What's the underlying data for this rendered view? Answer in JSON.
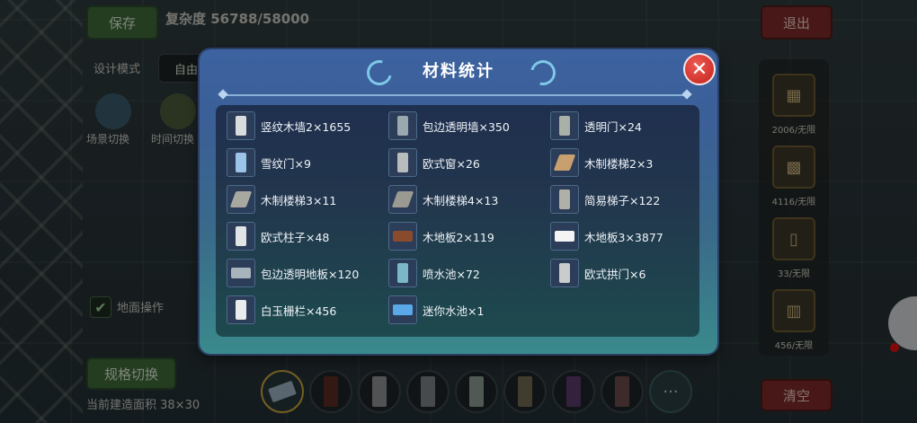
{
  "hud": {
    "save_label": "保存",
    "complexity_label": "复杂度 56788/58000",
    "exit_label": "退出",
    "design_mode_label": "设计模式",
    "free_label": "自由",
    "scene_switch_label": "场景切换",
    "time_switch_label": "时间切换",
    "ground_op_label": "地面操作",
    "spec_switch_label": "规格切换",
    "build_area_label": "当前建造面积 38×30",
    "clear_label": "清空"
  },
  "side_panel": {
    "items": [
      {
        "count": "2006/无限"
      },
      {
        "count": "4116/无限"
      },
      {
        "count": "33/无限"
      },
      {
        "count": "456/无限"
      }
    ]
  },
  "hotbar": {
    "slots": [
      {
        "color": "#9ab0c0",
        "selected": true
      },
      {
        "color": "#5a2a22"
      },
      {
        "color": "#8a8e90"
      },
      {
        "color": "#7a8084"
      },
      {
        "color": "#8a9a90"
      },
      {
        "color": "#6e6a50"
      },
      {
        "color": "#5a3a6a"
      },
      {
        "color": "#6a4a4a"
      }
    ],
    "more_label": "···"
  },
  "dialog": {
    "title": "材料统计",
    "close_label": "✕",
    "items": [
      {
        "label": "竖纹木墙2×1655",
        "icon": "vertical-wood-wall-icon",
        "color": "#d8dcdc"
      },
      {
        "label": "包边透明墙×350",
        "icon": "glass-wall-icon",
        "color": "#9aa8b0"
      },
      {
        "label": "透明门×24",
        "icon": "glass-door-icon",
        "color": "#a8b0a8"
      },
      {
        "label": "雪纹门×9",
        "icon": "snow-door-icon",
        "color": "#9ac4e8"
      },
      {
        "label": "欧式窗×26",
        "icon": "european-window-icon",
        "color": "#b8bcbc"
      },
      {
        "label": "木制楼梯2×3",
        "icon": "wood-stairs-icon",
        "color": "#c8a070"
      },
      {
        "label": "木制楼梯3×11",
        "icon": "wood-stairs-icon",
        "color": "#a8a8a0"
      },
      {
        "label": "木制楼梯4×13",
        "icon": "wood-stairs-icon",
        "color": "#9a9a92"
      },
      {
        "label": "简易梯子×122",
        "icon": "ladder-icon",
        "color": "#b0b0a8"
      },
      {
        "label": "欧式柱子×48",
        "icon": "pillar-icon",
        "color": "#e0e4e4"
      },
      {
        "label": "木地板2×119",
        "icon": "wood-floor-icon",
        "color": "#8a4a2e"
      },
      {
        "label": "木地板3×3877",
        "icon": "wood-floor-icon",
        "color": "#f4f4f4"
      },
      {
        "label": "包边透明地板×120",
        "icon": "glass-floor-icon",
        "color": "#a8b4bc"
      },
      {
        "label": "喷水池×72",
        "icon": "fountain-icon",
        "color": "#7ab8c8"
      },
      {
        "label": "欧式拱门×6",
        "icon": "arch-door-icon",
        "color": "#c8cccc"
      },
      {
        "label": "白玉栅栏×456",
        "icon": "fence-icon",
        "color": "#e8ecec"
      },
      {
        "label": "迷你水池×1",
        "icon": "mini-pool-icon",
        "color": "#5aa8e8"
      }
    ]
  }
}
